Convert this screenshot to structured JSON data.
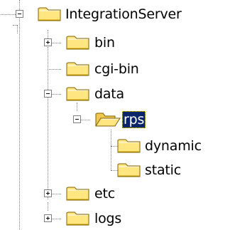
{
  "tree": {
    "root": {
      "label": "IntegrationServer",
      "state": "expanded",
      "icon": "folder-closed-icon"
    },
    "items": [
      {
        "label": "bin",
        "state": "collapsed",
        "icon": "folder-closed-icon"
      },
      {
        "label": "cgi-bin",
        "state": "leaf",
        "icon": "folder-closed-icon"
      },
      {
        "label": "data",
        "state": "expanded",
        "icon": "folder-closed-icon"
      },
      {
        "label": "rps",
        "state": "expanded",
        "icon": "folder-open-icon",
        "selected": true
      },
      {
        "label": "dynamic",
        "state": "leaf",
        "icon": "folder-closed-icon"
      },
      {
        "label": "static",
        "state": "leaf",
        "icon": "folder-closed-icon"
      },
      {
        "label": "etc",
        "state": "collapsed",
        "icon": "folder-closed-icon"
      },
      {
        "label": "logs",
        "state": "collapsed",
        "icon": "folder-closed-icon"
      }
    ]
  },
  "colors": {
    "folder_fill": "#ffe680",
    "folder_outline": "#806000",
    "selection_bg": "#0a246a",
    "selection_text": "#ffffff",
    "tree_lines": "#808080"
  }
}
